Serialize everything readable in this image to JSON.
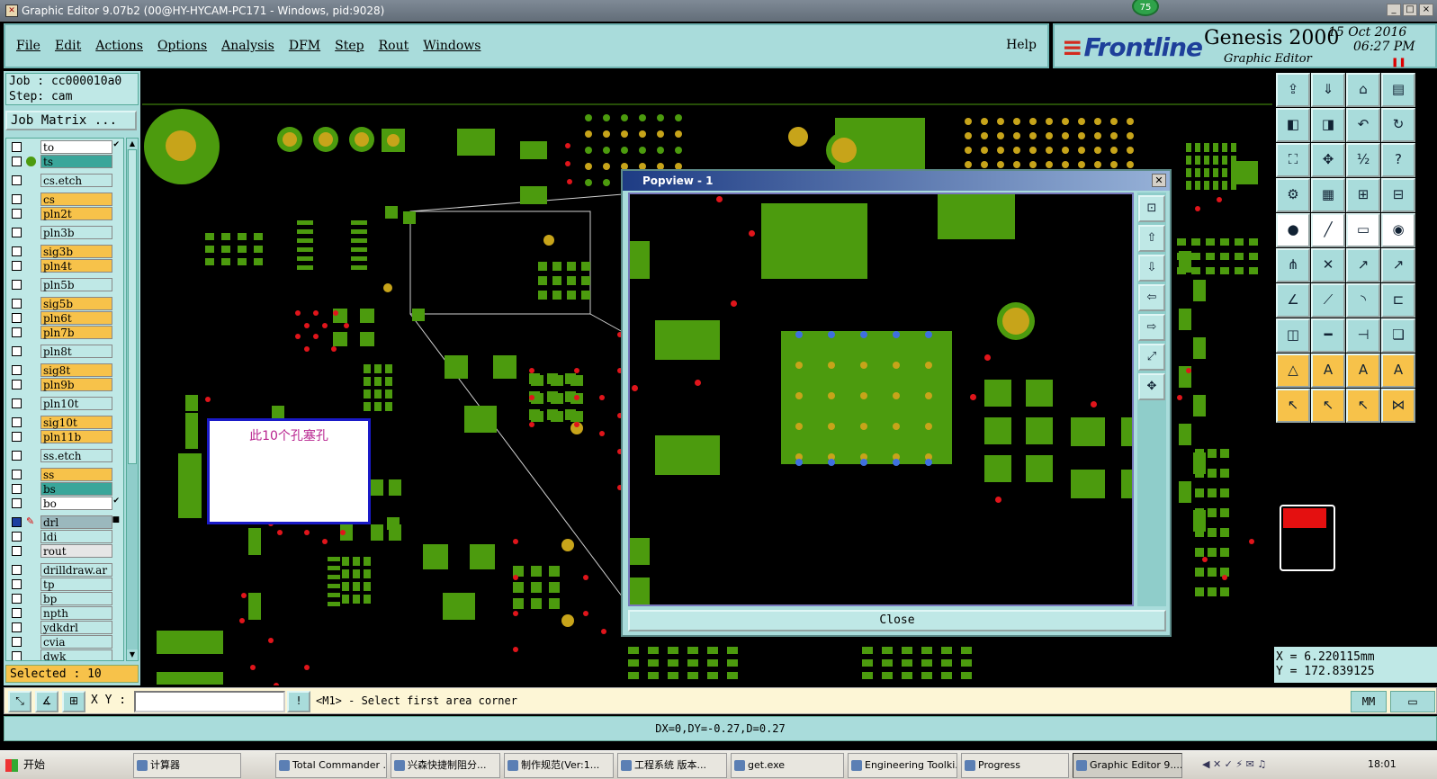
{
  "window": {
    "title": "Graphic Editor 9.07b2 (00@HY-HYCAM-PC171 - Windows, pid:9028)",
    "notification_count": "75",
    "controls": [
      "_",
      "□",
      "×"
    ]
  },
  "menu": {
    "items": [
      "File",
      "Edit",
      "Actions",
      "Options",
      "Analysis",
      "DFM",
      "Step",
      "Rout",
      "Windows"
    ],
    "help": "Help"
  },
  "brand": {
    "logo": "Frontline",
    "product": "Genesis 2000",
    "subtitle": "Graphic Editor",
    "date": "15 Oct 2016",
    "time": "06:27 PM"
  },
  "job": {
    "job_line": "Job : cc000010a0",
    "step_line": "Step: cam",
    "matrix_button": "Job Matrix ..."
  },
  "layers": [
    {
      "name": "to",
      "color": "#ffffff",
      "mark": "✔"
    },
    {
      "name": "ts",
      "color": "#3aa69a",
      "dot": true
    },
    {
      "name": "cs.etch",
      "color": "#bfe8e6"
    },
    {
      "name": "cs",
      "color": "#f7c24a"
    },
    {
      "name": "pln2t",
      "color": "#f7c24a"
    },
    {
      "name": "pln3b",
      "color": "#bfe8e6"
    },
    {
      "name": "sig3b",
      "color": "#f7c24a"
    },
    {
      "name": "pln4t",
      "color": "#f7c24a"
    },
    {
      "name": "pln5b",
      "color": "#bfe8e6"
    },
    {
      "name": "sig5b",
      "color": "#f7c24a"
    },
    {
      "name": "pln6t",
      "color": "#f7c24a"
    },
    {
      "name": "pln7b",
      "color": "#f7c24a"
    },
    {
      "name": "pln8t",
      "color": "#bfe8e6"
    },
    {
      "name": "sig8t",
      "color": "#f7c24a"
    },
    {
      "name": "pln9b",
      "color": "#f7c24a"
    },
    {
      "name": "pln10t",
      "color": "#bfe8e6"
    },
    {
      "name": "sig10t",
      "color": "#f7c24a"
    },
    {
      "name": "pln11b",
      "color": "#f7c24a"
    },
    {
      "name": "ss.etch",
      "color": "#bfe8e6"
    },
    {
      "name": "ss",
      "color": "#f7c24a"
    },
    {
      "name": "bs",
      "color": "#3aa69a"
    },
    {
      "name": "bo",
      "color": "#ffffff",
      "mark": "✔"
    },
    {
      "name": "drl",
      "color": "#9bb8bd",
      "mark": "■",
      "filled": true
    },
    {
      "name": "ldi",
      "color": "#bfe8e6"
    },
    {
      "name": "rout",
      "color": "#e6e6e6"
    },
    {
      "name": "drilldraw.ar",
      "color": "#bfe8e6"
    },
    {
      "name": "tp",
      "color": "#bfe8e6"
    },
    {
      "name": "bp",
      "color": "#bfe8e6"
    },
    {
      "name": "npth",
      "color": "#bfe8e6"
    },
    {
      "name": "ydkdrl",
      "color": "#bfe8e6"
    },
    {
      "name": "cvia",
      "color": "#bfe8e6"
    },
    {
      "name": "dwk",
      "color": "#bfe8e6"
    }
  ],
  "selected_text": "Selected : 10",
  "note": "此10个孔塞孔",
  "popview": {
    "title": "Popview - 1",
    "close": "Close"
  },
  "coords": {
    "x_line": "X = 6.220115mm",
    "y_line": "Y = 172.839125"
  },
  "command": {
    "xy_label": "X Y :",
    "input_value": "",
    "prompt": "<M1> - Select first area corner",
    "units": "MM"
  },
  "status": "DX=0,DY=-0.27,D=0.27",
  "taskbar": {
    "start": "开始",
    "items": [
      "计算器",
      "Total Commander ...",
      "兴森快捷制阻分...",
      "制作规范(Ver:1...",
      "工程系统 版本...",
      "get.exe",
      "Engineering Toolki...",
      "Progress",
      "Graphic Editor 9...."
    ],
    "clock": "18:01"
  }
}
